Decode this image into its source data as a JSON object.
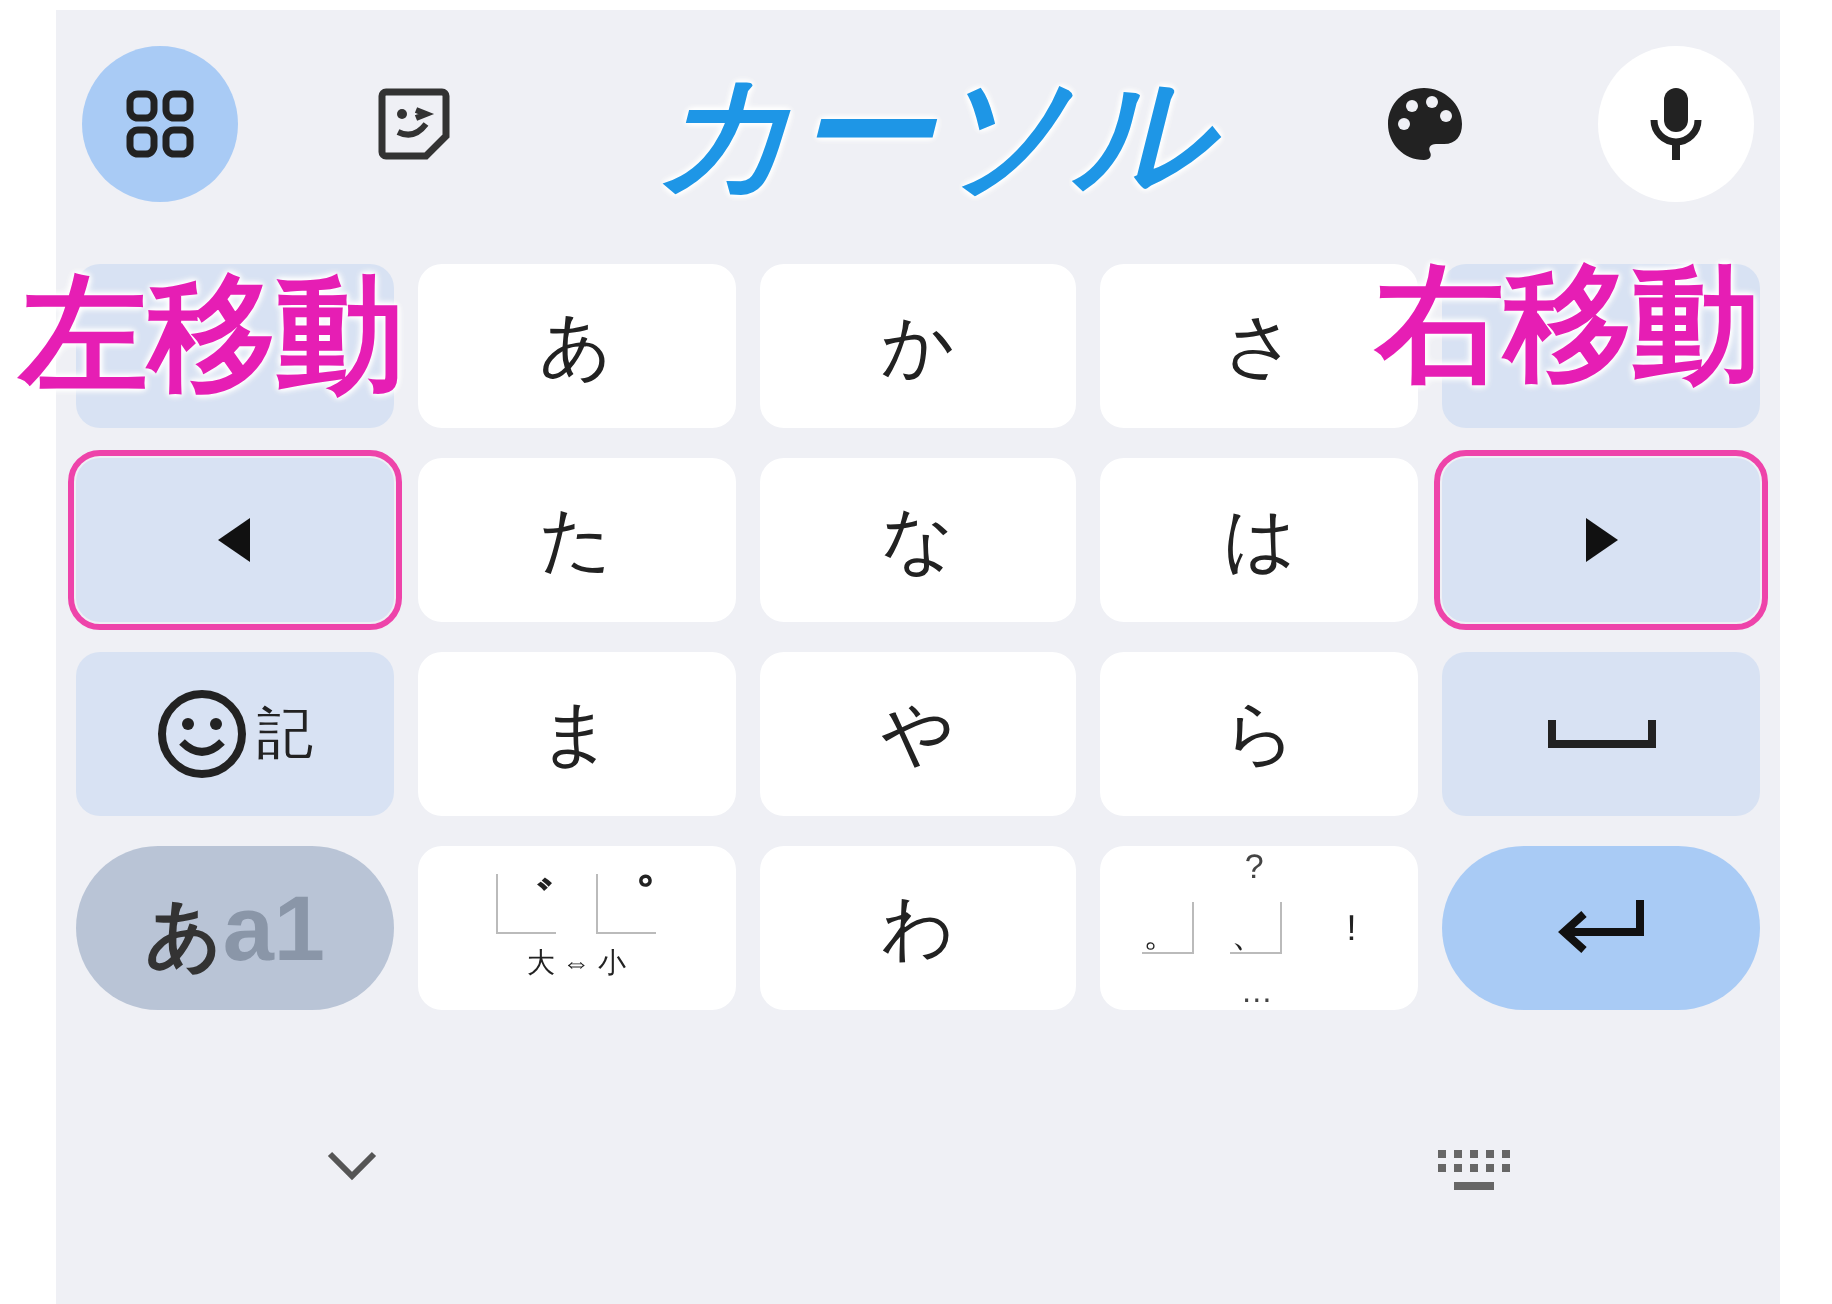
{
  "toolbar": [
    {
      "kind": "grid",
      "selected": true
    },
    {
      "kind": "sticker",
      "selected": false
    },
    {
      "kind": "palette",
      "selected": false
    },
    {
      "kind": "mic",
      "selected": false
    }
  ],
  "rows": [
    [
      {
        "kind": "side",
        "outlined": false
      },
      {
        "kind": "kana",
        "label": "あ",
        "outlined": false
      },
      {
        "kind": "kana",
        "label": "か",
        "outlined": false
      },
      {
        "kind": "kana",
        "label": "さ",
        "outlined": false
      },
      {
        "kind": "side",
        "outlined": false
      }
    ],
    [
      {
        "kind": "arrow-left",
        "outlined": true
      },
      {
        "kind": "kana",
        "label": "た",
        "outlined": false
      },
      {
        "kind": "kana",
        "label": "な",
        "outlined": false
      },
      {
        "kind": "kana",
        "label": "は",
        "outlined": false
      },
      {
        "kind": "arrow-right",
        "outlined": true
      }
    ],
    [
      {
        "kind": "symbols",
        "label": "記",
        "outlined": false
      },
      {
        "kind": "kana",
        "label": "ま",
        "outlined": false
      },
      {
        "kind": "kana",
        "label": "や",
        "outlined": false
      },
      {
        "kind": "kana",
        "label": "ら",
        "outlined": false
      },
      {
        "kind": "space",
        "outlined": false
      }
    ],
    [
      {
        "kind": "mode",
        "label": "あ",
        "sublabel": "a1",
        "outlined": false
      },
      {
        "kind": "dakuten",
        "marks": [
          "゛",
          "゜"
        ],
        "caption": "大 ⇔ 小",
        "outlined": false
      },
      {
        "kind": "kana",
        "label": "わ",
        "outlined": false
      },
      {
        "kind": "punct",
        "top": "?",
        "marks": [
          "。",
          "、"
        ],
        "right": "!",
        "bottom": "…",
        "outlined": false
      },
      {
        "kind": "enter",
        "outlined": false
      }
    ]
  ],
  "annotations": [
    {
      "kind": "heading",
      "text": "カーソル",
      "color": "#1e96e6"
    },
    {
      "kind": "callout-left",
      "text": "左移動",
      "color": "#e61eb4"
    },
    {
      "kind": "callout-right",
      "text": "右移動",
      "color": "#e61eb4"
    }
  ]
}
